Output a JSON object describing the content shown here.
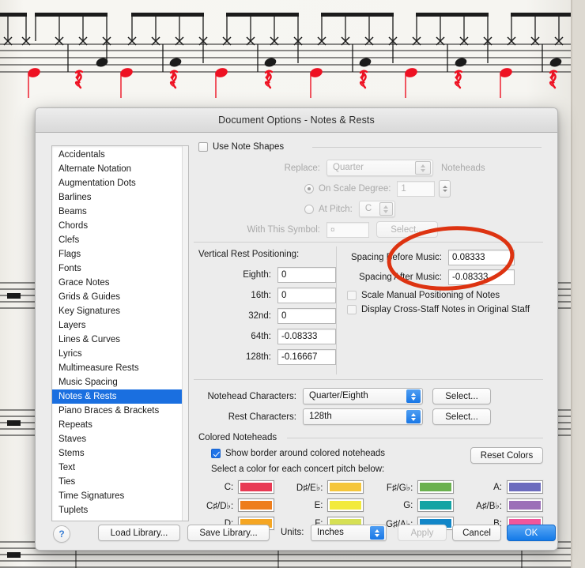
{
  "window": {
    "title": "Document Options - Notes & Rests"
  },
  "sidebar": {
    "items": [
      {
        "label": "Accidentals",
        "selected": false
      },
      {
        "label": "Alternate Notation",
        "selected": false
      },
      {
        "label": "Augmentation Dots",
        "selected": false
      },
      {
        "label": "Barlines",
        "selected": false
      },
      {
        "label": "Beams",
        "selected": false
      },
      {
        "label": "Chords",
        "selected": false
      },
      {
        "label": "Clefs",
        "selected": false
      },
      {
        "label": "Flags",
        "selected": false
      },
      {
        "label": "Fonts",
        "selected": false
      },
      {
        "label": "Grace Notes",
        "selected": false
      },
      {
        "label": "Grids & Guides",
        "selected": false
      },
      {
        "label": "Key Signatures",
        "selected": false
      },
      {
        "label": "Layers",
        "selected": false
      },
      {
        "label": "Lines & Curves",
        "selected": false
      },
      {
        "label": "Lyrics",
        "selected": false
      },
      {
        "label": "Multimeasure Rests",
        "selected": false
      },
      {
        "label": "Music Spacing",
        "selected": false
      },
      {
        "label": "Notes & Rests",
        "selected": true
      },
      {
        "label": "Piano Braces & Brackets",
        "selected": false
      },
      {
        "label": "Repeats",
        "selected": false
      },
      {
        "label": "Staves",
        "selected": false
      },
      {
        "label": "Stems",
        "selected": false
      },
      {
        "label": "Text",
        "selected": false
      },
      {
        "label": "Ties",
        "selected": false
      },
      {
        "label": "Time Signatures",
        "selected": false
      },
      {
        "label": "Tuplets",
        "selected": false
      }
    ]
  },
  "note_shapes": {
    "use_note_shapes_label": "Use Note Shapes",
    "use_note_shapes_checked": false,
    "replace_label": "Replace:",
    "replace_value": "Quarter",
    "noteheads_label": "Noteheads",
    "on_scale_degree_label": "On Scale Degree:",
    "on_scale_degree_selected": true,
    "on_scale_degree_value": "1",
    "at_pitch_label": "At Pitch:",
    "at_pitch_selected": false,
    "at_pitch_value": "C",
    "with_this_symbol_label": "With This Symbol:",
    "with_this_symbol_value": "¤",
    "select_label": "Select..."
  },
  "vertical_rest_positioning": {
    "section_label": "Vertical Rest Positioning:",
    "rows": [
      {
        "label": "Eighth:",
        "value": "0"
      },
      {
        "label": "16th:",
        "value": "0"
      },
      {
        "label": "32nd:",
        "value": "0"
      },
      {
        "label": "64th:",
        "value": "-0.08333"
      },
      {
        "label": "128th:",
        "value": "-0.16667"
      }
    ]
  },
  "spacing": {
    "before_label": "Spacing Before Music:",
    "before_value": "0.08333",
    "after_label": "Spacing After Music:",
    "after_value": "-0.08333",
    "scale_manual_label": "Scale Manual Positioning of Notes",
    "scale_manual_checked": false,
    "cross_staff_label": "Display Cross-Staff Notes in Original Staff",
    "cross_staff_checked": false
  },
  "characters": {
    "notehead_label": "Notehead Characters:",
    "notehead_value": "Quarter/Eighth",
    "notehead_select_label": "Select...",
    "rest_label": "Rest Characters:",
    "rest_value": "128th",
    "rest_select_label": "Select..."
  },
  "colored_noteheads": {
    "section_label": "Colored Noteheads",
    "show_border_label": "Show border around colored noteheads",
    "show_border_checked": true,
    "reset_colors_label": "Reset Colors",
    "instruction_label": "Select a color for each concert pitch below:",
    "columns": [
      [
        {
          "pitch": "C:",
          "color": "#e83a54"
        },
        {
          "pitch": "C♯/D♭:",
          "color": "#ee7d1c"
        },
        {
          "pitch": "D:",
          "color": "#f5a623"
        }
      ],
      [
        {
          "pitch": "D♯/E♭:",
          "color": "#f5c63c"
        },
        {
          "pitch": "E:",
          "color": "#f2ea3c"
        },
        {
          "pitch": "F:",
          "color": "#d6e055"
        }
      ],
      [
        {
          "pitch": "F♯/G♭:",
          "color": "#6bb14f"
        },
        {
          "pitch": "G:",
          "color": "#12a4a4"
        },
        {
          "pitch": "G♯/A♭:",
          "color": "#1286c8"
        }
      ],
      [
        {
          "pitch": "A:",
          "color": "#6c6cbe"
        },
        {
          "pitch": "A♯/B♭:",
          "color": "#9c6fb8"
        },
        {
          "pitch": "B:",
          "color": "#f0569b"
        }
      ]
    ]
  },
  "footer": {
    "help_label": "?",
    "load_library_label": "Load Library...",
    "save_library_label": "Save Library...",
    "units_label": "Units:",
    "units_value": "Inches",
    "apply_label": "Apply",
    "apply_enabled": false,
    "cancel_label": "Cancel",
    "ok_label": "OK"
  },
  "annotation": {
    "shape": "red-ellipse",
    "color": "#dd3311"
  },
  "background": {
    "description": "drum-set music notation staff with X noteheads, black noteheads and red notes/rests",
    "red_note_color": "#ee1122",
    "staff_color": "#1a1a1a"
  }
}
